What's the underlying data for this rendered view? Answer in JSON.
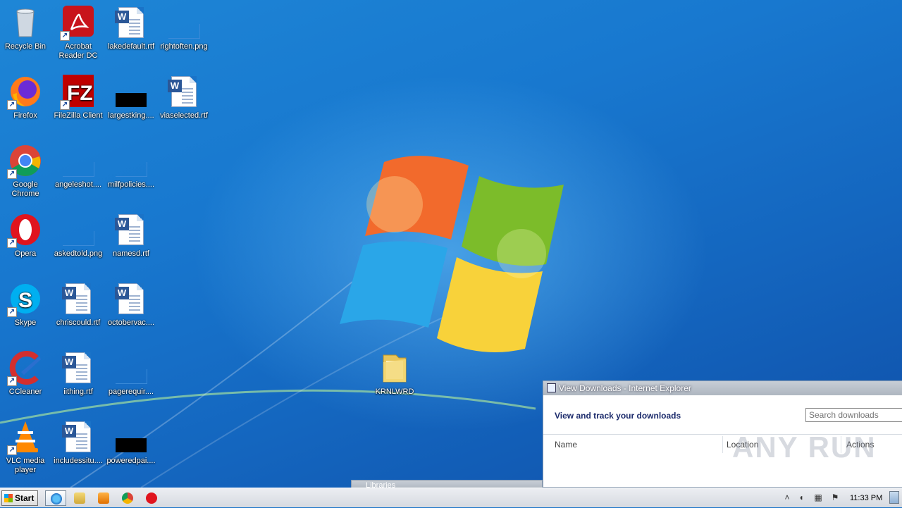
{
  "desktop": {
    "icons": [
      {
        "label": "Recycle Bin",
        "icon": "recycle-bin-icon"
      },
      {
        "label": "Acrobat Reader DC",
        "icon": "acrobat-reader-icon"
      },
      {
        "label": "lakedefault.rtf",
        "icon": "rtf-document-icon"
      },
      {
        "label": "rightoften.png",
        "icon": "png-file-icon"
      },
      {
        "label": "Firefox",
        "icon": "firefox-icon"
      },
      {
        "label": "FileZilla Client",
        "icon": "filezilla-icon"
      },
      {
        "label": "largestking....",
        "icon": "black-image-icon"
      },
      {
        "label": "viaselected.rtf",
        "icon": "rtf-document-icon"
      },
      {
        "label": "Google Chrome",
        "icon": "chrome-icon"
      },
      {
        "label": "angeleshot....",
        "icon": "png-file-icon"
      },
      {
        "label": "milfpolicies....",
        "icon": "png-file-icon"
      },
      {
        "label": "Opera",
        "icon": "opera-icon"
      },
      {
        "label": "askedtold.png",
        "icon": "png-file-icon"
      },
      {
        "label": "namesd.rtf",
        "icon": "rtf-document-icon"
      },
      {
        "label": "Skype",
        "icon": "skype-icon"
      },
      {
        "label": "chriscould.rtf",
        "icon": "rtf-document-icon"
      },
      {
        "label": "octobervac....",
        "icon": "rtf-document-icon"
      },
      {
        "label": "CCleaner",
        "icon": "ccleaner-icon"
      },
      {
        "label": "iithing.rtf",
        "icon": "rtf-document-icon"
      },
      {
        "label": "pagerequir....",
        "icon": "png-file-icon"
      },
      {
        "label": "VLC media player",
        "icon": "vlc-icon"
      },
      {
        "label": "includessitu....",
        "icon": "rtf-document-icon"
      },
      {
        "label": "poweredpai....",
        "icon": "black-image-icon"
      },
      {
        "label": "KRNLWRD",
        "icon": "folder-icon"
      }
    ]
  },
  "downloads_window": {
    "title": "View Downloads - Internet Explorer",
    "heading": "View and track your downloads",
    "search_placeholder": "Search downloads",
    "columns": [
      "Name",
      "Location",
      "Actions"
    ],
    "watermark": "ANY RUN"
  },
  "libraries_window": {
    "title": "Libraries"
  },
  "taskbar": {
    "start_label": "Start",
    "apps": [
      "internet-explorer-icon",
      "explorer-icon",
      "media-player-icon",
      "chrome-icon",
      "opera-icon"
    ],
    "clock": "11:33 PM"
  },
  "colors": {
    "desktop": "#1a73c8",
    "taskbar": "#dfe3e8"
  }
}
